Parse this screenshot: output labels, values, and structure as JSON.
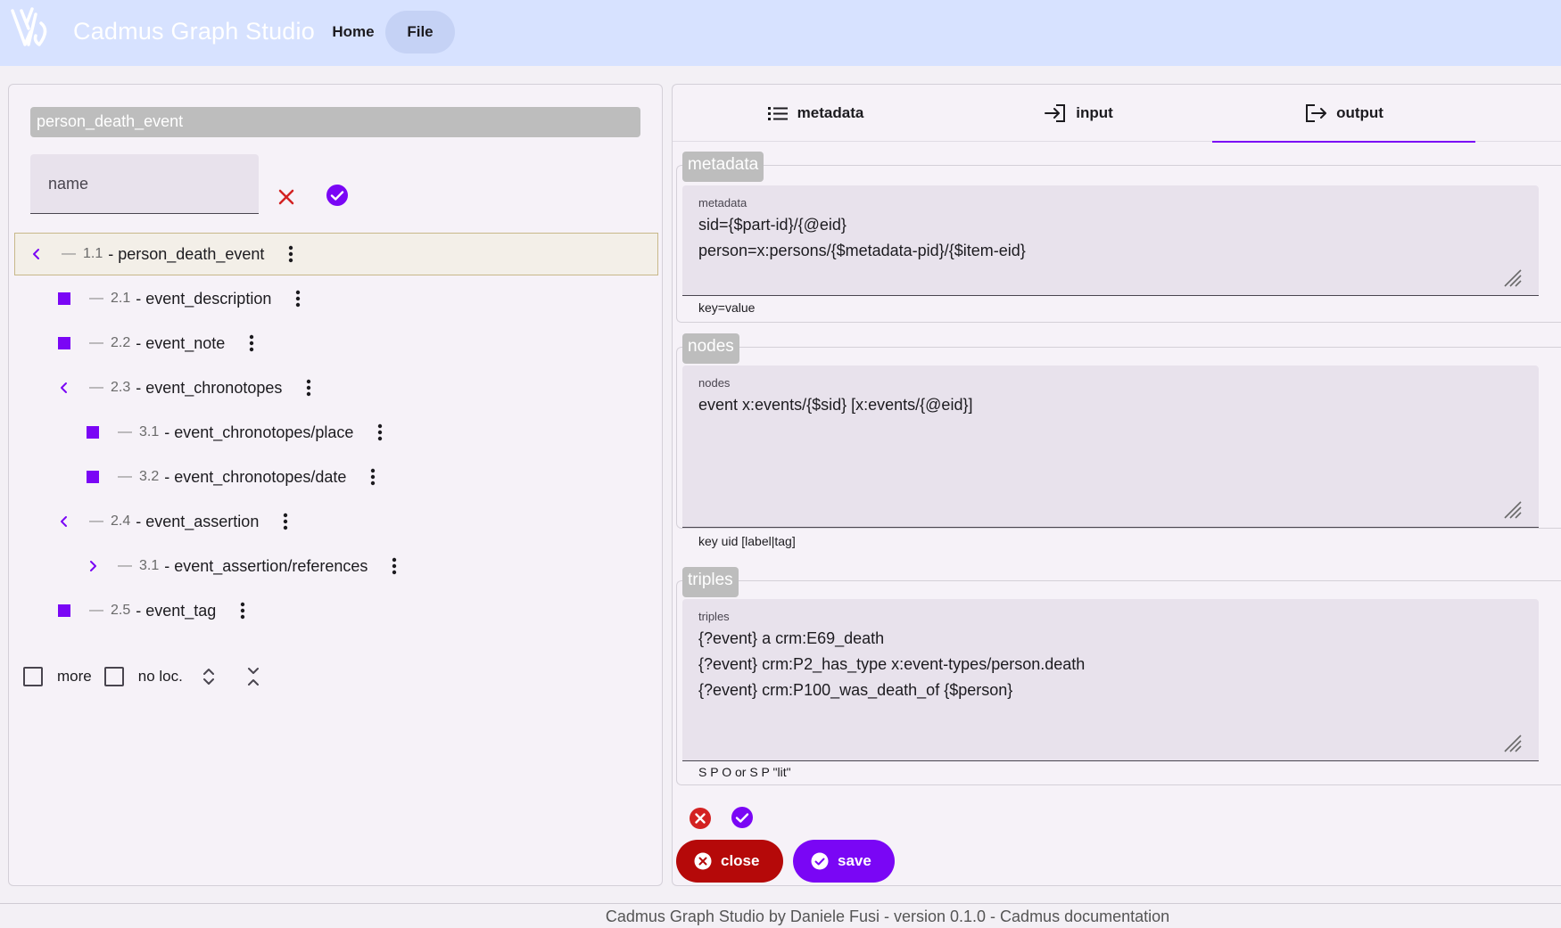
{
  "app": {
    "title": "Cadmus Graph Studio",
    "nav": {
      "home": "Home",
      "file": "File"
    }
  },
  "left": {
    "mapping_name": "person_death_event",
    "name_placeholder": "name",
    "tree": [
      {
        "toggle": "collapse",
        "num": "1.1",
        "label": "- person_death_event",
        "selected": true
      },
      {
        "toggle": "leaf",
        "num": "2.1",
        "label": "- event_description"
      },
      {
        "toggle": "leaf",
        "num": "2.2",
        "label": "- event_note"
      },
      {
        "toggle": "collapse",
        "num": "2.3",
        "label": "- event_chronotopes"
      },
      {
        "toggle": "leaf",
        "num": "3.1",
        "label": "- event_chronotopes/place"
      },
      {
        "toggle": "leaf",
        "num": "3.2",
        "label": "- event_chronotopes/date"
      },
      {
        "toggle": "collapse",
        "num": "2.4",
        "label": "- event_assertion"
      },
      {
        "toggle": "expand",
        "num": "3.1",
        "label": "- event_assertion/references"
      },
      {
        "toggle": "leaf",
        "num": "2.5",
        "label": "- event_tag"
      }
    ],
    "options": {
      "more": "more",
      "no_loc": "no loc."
    }
  },
  "right": {
    "tabs": {
      "metadata": "metadata",
      "input": "input",
      "output": "output"
    },
    "metadata": {
      "legend": "metadata",
      "label": "metadata",
      "value": "sid={$part-id}/{@eid}\nperson=x:persons/{$metadata-pid}/{$item-eid}",
      "hint": "key=value"
    },
    "nodes": {
      "legend": "nodes",
      "label": "nodes",
      "value": "event x:events/{$sid} [x:events/{@eid}]",
      "hint": "key uid [label|tag]"
    },
    "triples": {
      "legend": "triples",
      "label": "triples",
      "value": "{?event} a crm:E69_death\n{?event} crm:P2_has_type x:event-types/person.death\n{?event} crm:P100_was_death_of {$person}",
      "hint": "S P O or S P \"lit\""
    },
    "buttons": {
      "close": "close",
      "save": "save"
    }
  },
  "footer": {
    "text": "Cadmus Graph Studio by Daniele Fusi - version 0.1.0 - ",
    "link": "Cadmus documentation"
  },
  "colors": {
    "accent": "#7a06f5",
    "danger": "#b50909",
    "topbar": "#d7e2ff"
  }
}
